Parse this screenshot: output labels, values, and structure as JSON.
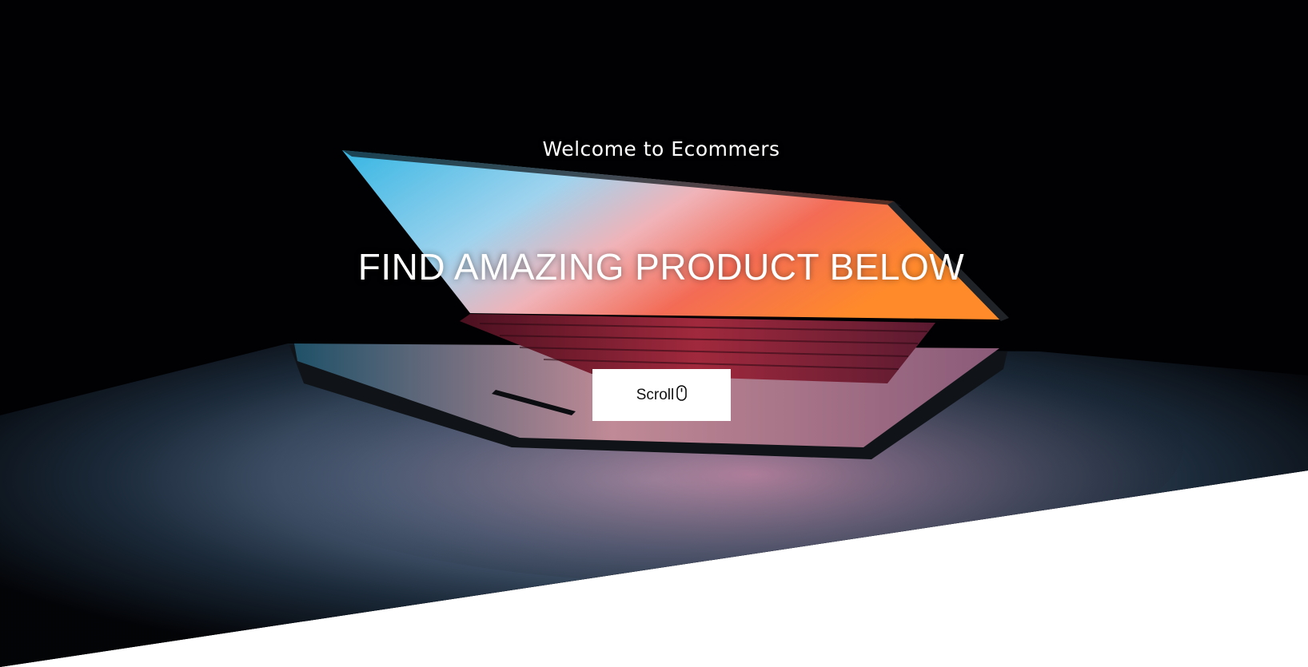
{
  "hero": {
    "welcome": "Welcome to Ecommers",
    "headline": "FIND AMAZING PRODUCT BELOW",
    "scroll_button": {
      "label": "Scroll",
      "icon": "mouse-icon"
    },
    "background_image": "laptop-photo",
    "colors": {
      "background": "#010103",
      "text": "#ffffff",
      "button_background": "#ffffff",
      "button_text": "#111111"
    }
  }
}
